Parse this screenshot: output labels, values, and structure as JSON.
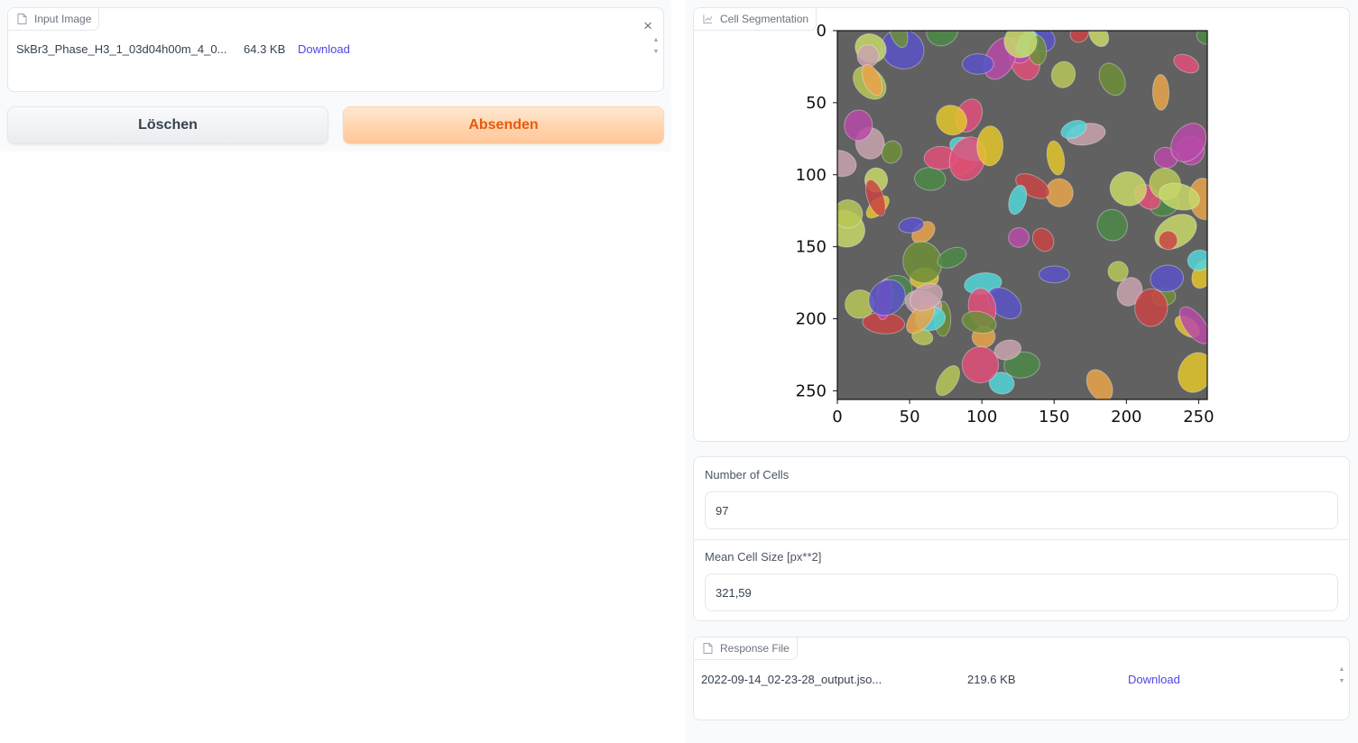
{
  "input_image": {
    "label": "Input Image",
    "file_name": "SkBr3_Phase_H3_1_03d04h00m_4_0...",
    "file_size": "64.3 KB",
    "download_label": "Download",
    "close_glyph": "×"
  },
  "buttons": {
    "clear_label": "Löschen",
    "submit_label": "Absenden"
  },
  "segmentation": {
    "label": "Cell Segmentation",
    "chart_data": {
      "type": "heatmap",
      "title": "",
      "x_ticks": [
        "0",
        "50",
        "100",
        "150",
        "200",
        "250"
      ],
      "y_ticks": [
        "0",
        "50",
        "100",
        "150",
        "200",
        "250"
      ],
      "xlim": [
        0,
        256
      ],
      "ylim": [
        256,
        0
      ],
      "background": "#616161",
      "palette": [
        "#b94aa8",
        "#e0507a",
        "#6f8f3a",
        "#e3c62c",
        "#5a53c8",
        "#53d6d9",
        "#c9a3ae",
        "#e9a54a",
        "#c94545",
        "#4e8a49",
        "#b8c757",
        "#c8d86a"
      ]
    }
  },
  "stats": {
    "cells_label": "Number of Cells",
    "cells_value": "97",
    "size_label": "Mean Cell Size [px**2]",
    "size_value": "321,59"
  },
  "response_file": {
    "label": "Response File",
    "file_name": "2022-09-14_02-23-28_output.jso...",
    "file_size": "219.6 KB",
    "download_label": "Download"
  },
  "icons": {
    "file": "file-icon",
    "chart": "chart-icon",
    "close": "close-icon"
  }
}
